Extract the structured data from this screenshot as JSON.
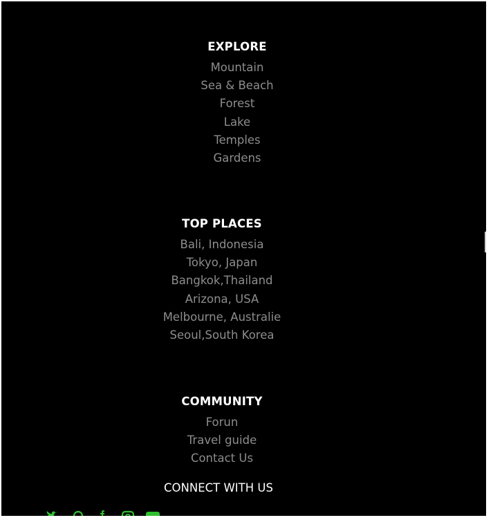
{
  "explore": {
    "title": "EXPLORE",
    "items": [
      "Mountain",
      "Sea & Beach",
      "Forest",
      "Lake",
      "Temples",
      "Gardens"
    ]
  },
  "top_places": {
    "title": "TOP PLACES",
    "items": [
      "Bali, Indonesia",
      "Tokyo, Japan",
      "Bangkok,Thailand",
      "Arizona, USA",
      "Melbourne, Australie",
      "Seoul,South Korea"
    ]
  },
  "community": {
    "title": "COMMUNITY",
    "items": [
      "Forun",
      "Travel guide",
      "Contact Us"
    ]
  },
  "connect": {
    "title": "CONNECT WITH US",
    "icons": [
      "twitter-icon",
      "whatsapp-icon",
      "facebook-icon",
      "instagram-icon",
      "youtube-icon"
    ],
    "icon_color": "#2fbf2f"
  },
  "colors": {
    "background": "#000000",
    "heading": "#ffffff",
    "link": "#8d8d8d"
  }
}
